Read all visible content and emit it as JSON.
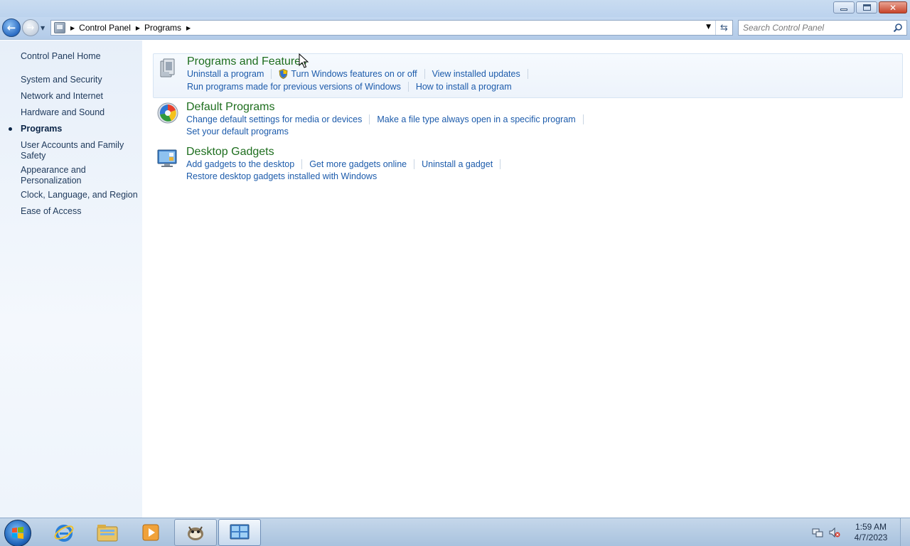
{
  "navigation": {
    "breadcrumbs": [
      "Control Panel",
      "Programs"
    ],
    "search_placeholder": "Search Control Panel"
  },
  "sidebar": {
    "items": [
      {
        "label": "Control Panel Home"
      },
      {
        "label": "System and Security"
      },
      {
        "label": "Network and Internet"
      },
      {
        "label": "Hardware and Sound"
      },
      {
        "label": "Programs",
        "active": true
      },
      {
        "label": "User Accounts and Family Safety"
      },
      {
        "label": "Appearance and Personalization"
      },
      {
        "label": "Clock, Language, and Region"
      },
      {
        "label": "Ease of Access"
      }
    ]
  },
  "categories": [
    {
      "title": "Programs and Features",
      "icon": "programs-features-icon",
      "tasks_row1": [
        "Uninstall a program",
        "Turn Windows features on or off",
        "View installed updates"
      ],
      "tasks_row2": [
        "Run programs made for previous versions of Windows",
        "How to install a program"
      ]
    },
    {
      "title": "Default Programs",
      "icon": "default-programs-icon",
      "tasks_row1": [
        "Change default settings for media or devices",
        "Make a file type always open in a specific program"
      ],
      "tasks_row2": [
        "Set your default programs"
      ]
    },
    {
      "title": "Desktop Gadgets",
      "icon": "desktop-gadgets-icon",
      "tasks_row1": [
        "Add gadgets to the desktop",
        "Get more gadgets online",
        "Uninstall a gadget"
      ],
      "tasks_row2": [
        "Restore desktop gadgets installed with Windows"
      ]
    }
  ],
  "taskbar": {
    "clock_time": "1:59 AM",
    "clock_date": "4/7/2023",
    "pinned": [
      "internet-explorer-icon",
      "windows-explorer-icon",
      "media-player-icon",
      "gimp-icon",
      "control-panel-icon"
    ]
  },
  "colors": {
    "category_title": "#1e6e1e",
    "task_link": "#1c5bab",
    "sidebar_link": "#1e395b"
  }
}
